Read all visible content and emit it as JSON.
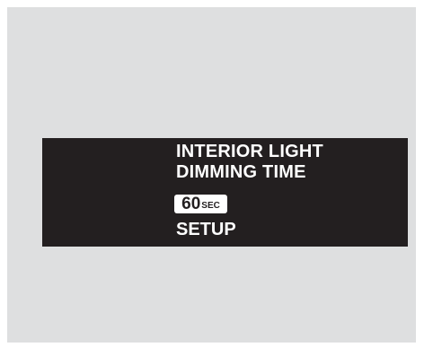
{
  "colors": {
    "panel_background": "#dedfe0",
    "display_background": "#231f20",
    "display_text": "#ffffff",
    "value_box_background": "#ffffff",
    "value_box_text": "#231f20"
  },
  "display": {
    "title_line1": "INTERIOR LIGHT",
    "title_line2": "DIMMING TIME",
    "value": "60",
    "value_unit": "SEC",
    "action_label": "SETUP"
  }
}
